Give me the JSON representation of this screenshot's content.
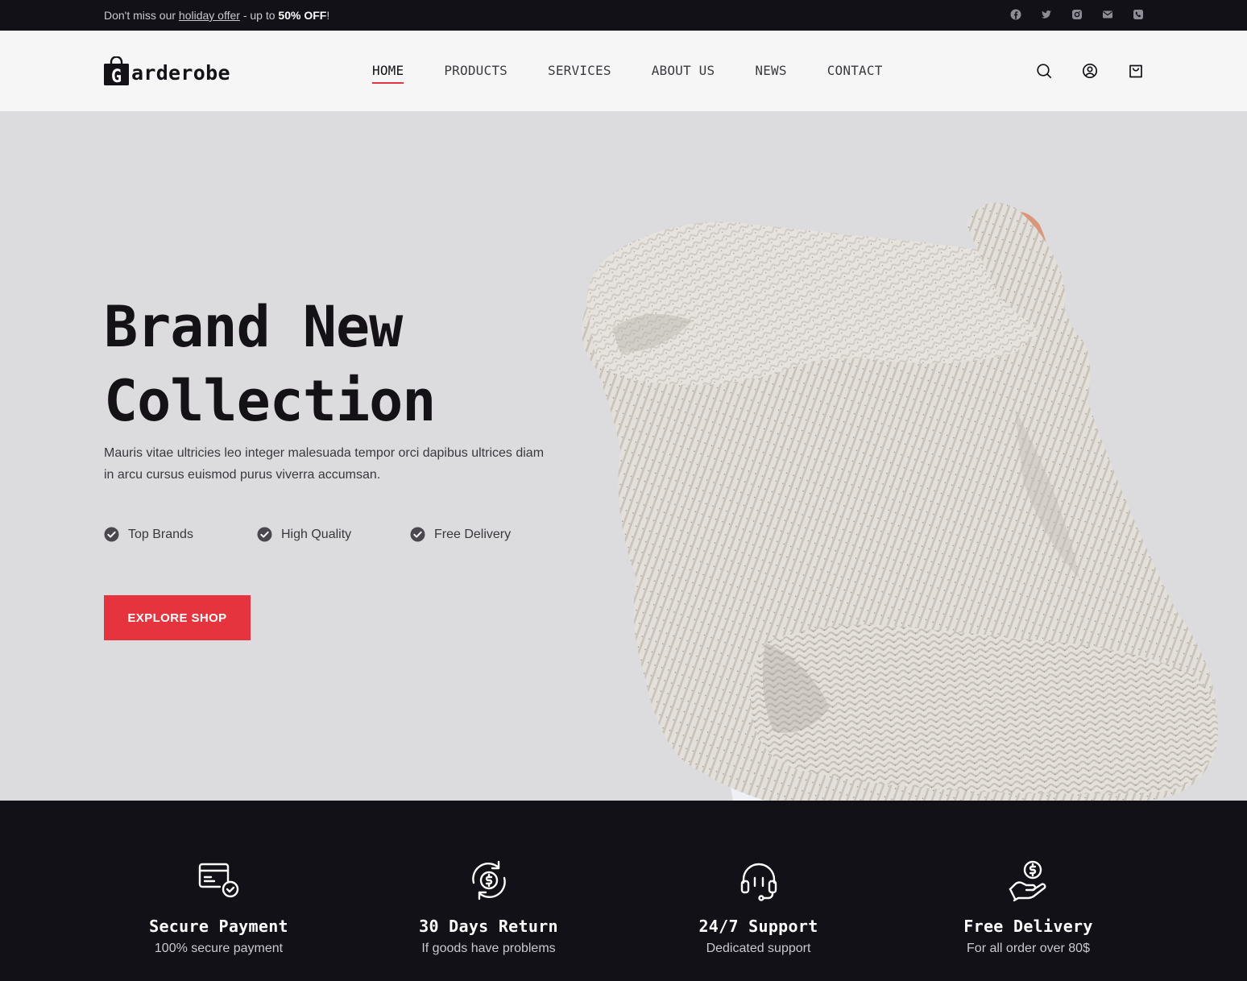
{
  "topbar": {
    "promo_prefix": "Don't miss our ",
    "promo_link": "holiday offer",
    "promo_middle": " - up to ",
    "promo_bold": "50% OFF",
    "promo_suffix": "!",
    "social_icons": [
      "facebook-icon",
      "twitter-icon",
      "instagram-icon",
      "mail-icon",
      "phone-icon"
    ]
  },
  "header": {
    "logo_letter": "G",
    "logo_text": "arderobe",
    "nav": [
      {
        "label": "HOME",
        "active": true
      },
      {
        "label": "PRODUCTS"
      },
      {
        "label": "SERVICES"
      },
      {
        "label": "ABOUT US"
      },
      {
        "label": "NEWS"
      },
      {
        "label": "CONTACT"
      }
    ],
    "icons": [
      "search-icon",
      "user-icon",
      "cart-icon"
    ]
  },
  "hero": {
    "title_line1": "Brand New",
    "title_line2": "Collection",
    "description": "Mauris vitae ultricies leo integer malesuada tempor orci dapibus ultrices diam in arcu cursus euismod purus viverra accumsan.",
    "features": [
      "Top Brands",
      "High Quality",
      "Free Delivery"
    ],
    "cta_label": "EXPLORE SHOP"
  },
  "benefits": [
    {
      "icon": "credit-card-check-icon",
      "title": "Secure Payment",
      "subtitle": "100% secure payment"
    },
    {
      "icon": "money-return-icon",
      "title": "30 Days Return",
      "subtitle": "If goods have problems"
    },
    {
      "icon": "headset-icon",
      "title": "24/7 Support",
      "subtitle": "Dedicated support"
    },
    {
      "icon": "hand-coin-icon",
      "title": "Free Delivery",
      "subtitle": "For all order over 80$"
    }
  ],
  "colors": {
    "accent": "#e5343e",
    "dark": "#131118",
    "hero_bg": "#dcdcde",
    "header_bg": "#f7f8f7"
  }
}
